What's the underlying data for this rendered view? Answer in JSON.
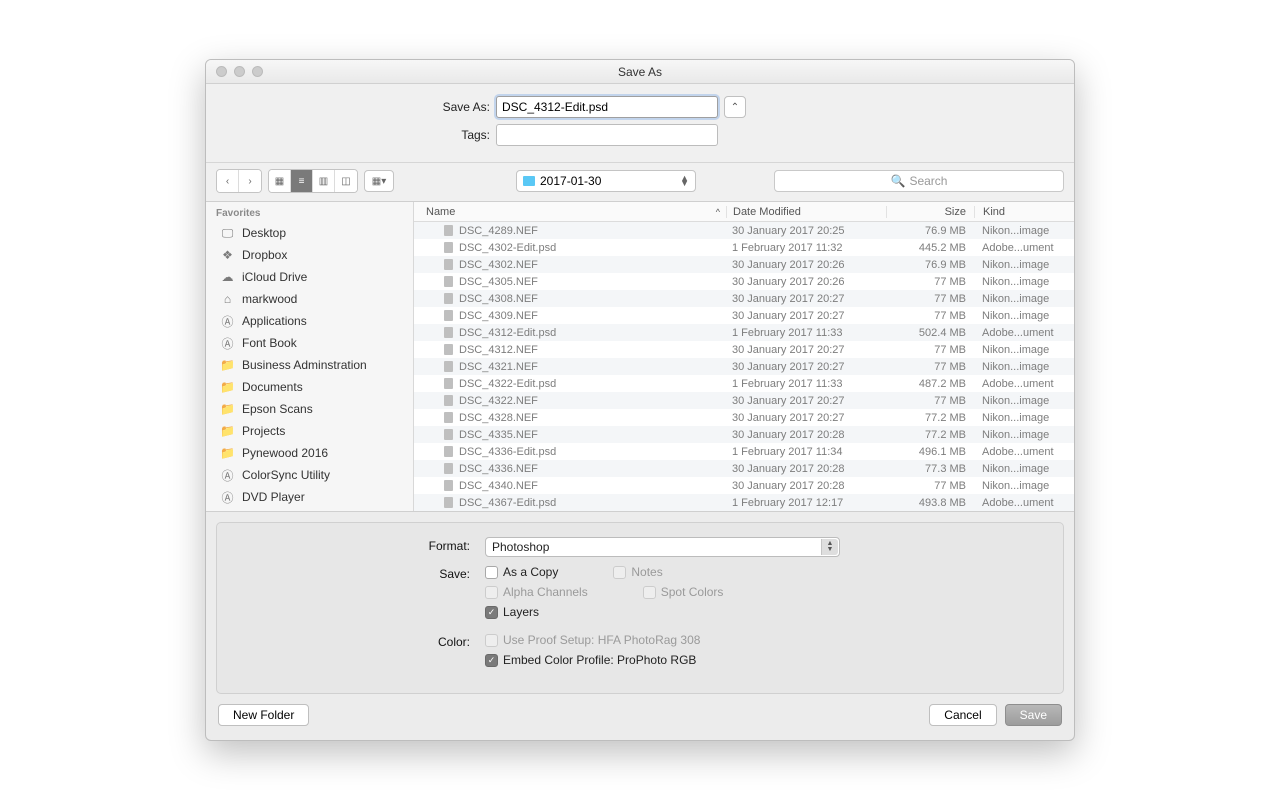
{
  "window": {
    "title": "Save As"
  },
  "form": {
    "saveas_label": "Save As:",
    "saveas_value": "DSC_4312-Edit.psd",
    "tags_label": "Tags:",
    "tags_value": ""
  },
  "location": {
    "folder": "2017-01-30"
  },
  "search": {
    "placeholder": "Search"
  },
  "sidebar": {
    "section": "Favorites",
    "items": [
      {
        "icon": "desktop",
        "label": "Desktop"
      },
      {
        "icon": "dropbox",
        "label": "Dropbox"
      },
      {
        "icon": "cloud",
        "label": "iCloud Drive"
      },
      {
        "icon": "home",
        "label": "markwood"
      },
      {
        "icon": "app",
        "label": "Applications"
      },
      {
        "icon": "app",
        "label": "Font Book"
      },
      {
        "icon": "folder",
        "label": "Business Adminstration"
      },
      {
        "icon": "folder",
        "label": "Documents"
      },
      {
        "icon": "folder",
        "label": "Epson Scans"
      },
      {
        "icon": "folder",
        "label": "Projects"
      },
      {
        "icon": "folder",
        "label": "Pynewood 2016"
      },
      {
        "icon": "app",
        "label": "ColorSync Utility"
      },
      {
        "icon": "app",
        "label": "DVD Player"
      }
    ]
  },
  "columns": {
    "name": "Name",
    "date": "Date Modified",
    "size": "Size",
    "kind": "Kind"
  },
  "files": [
    {
      "name": "DSC_4289.NEF",
      "date": "30 January 2017 20:25",
      "size": "76.9 MB",
      "kind": "Nikon...image"
    },
    {
      "name": "DSC_4302-Edit.psd",
      "date": "1 February 2017 11:32",
      "size": "445.2 MB",
      "kind": "Adobe...ument"
    },
    {
      "name": "DSC_4302.NEF",
      "date": "30 January 2017 20:26",
      "size": "76.9 MB",
      "kind": "Nikon...image"
    },
    {
      "name": "DSC_4305.NEF",
      "date": "30 January 2017 20:26",
      "size": "77 MB",
      "kind": "Nikon...image"
    },
    {
      "name": "DSC_4308.NEF",
      "date": "30 January 2017 20:27",
      "size": "77 MB",
      "kind": "Nikon...image"
    },
    {
      "name": "DSC_4309.NEF",
      "date": "30 January 2017 20:27",
      "size": "77 MB",
      "kind": "Nikon...image"
    },
    {
      "name": "DSC_4312-Edit.psd",
      "date": "1 February 2017 11:33",
      "size": "502.4 MB",
      "kind": "Adobe...ument"
    },
    {
      "name": "DSC_4312.NEF",
      "date": "30 January 2017 20:27",
      "size": "77 MB",
      "kind": "Nikon...image"
    },
    {
      "name": "DSC_4321.NEF",
      "date": "30 January 2017 20:27",
      "size": "77 MB",
      "kind": "Nikon...image"
    },
    {
      "name": "DSC_4322-Edit.psd",
      "date": "1 February 2017 11:33",
      "size": "487.2 MB",
      "kind": "Adobe...ument"
    },
    {
      "name": "DSC_4322.NEF",
      "date": "30 January 2017 20:27",
      "size": "77 MB",
      "kind": "Nikon...image"
    },
    {
      "name": "DSC_4328.NEF",
      "date": "30 January 2017 20:27",
      "size": "77.2 MB",
      "kind": "Nikon...image"
    },
    {
      "name": "DSC_4335.NEF",
      "date": "30 January 2017 20:28",
      "size": "77.2 MB",
      "kind": "Nikon...image"
    },
    {
      "name": "DSC_4336-Edit.psd",
      "date": "1 February 2017 11:34",
      "size": "496.1 MB",
      "kind": "Adobe...ument"
    },
    {
      "name": "DSC_4336.NEF",
      "date": "30 January 2017 20:28",
      "size": "77.3 MB",
      "kind": "Nikon...image"
    },
    {
      "name": "DSC_4340.NEF",
      "date": "30 January 2017 20:28",
      "size": "77 MB",
      "kind": "Nikon...image"
    },
    {
      "name": "DSC_4367-Edit.psd",
      "date": "1 February 2017 12:17",
      "size": "493.8 MB",
      "kind": "Adobe...ument"
    }
  ],
  "options": {
    "format_label": "Format:",
    "format_value": "Photoshop",
    "save_label": "Save:",
    "as_copy": "As a Copy",
    "notes": "Notes",
    "alpha": "Alpha Channels",
    "spot": "Spot Colors",
    "layers": "Layers",
    "color_label": "Color:",
    "proof_prefix": "Use Proof Setup:  ",
    "proof_value": "HFA PhotoRag 308",
    "embed_prefix": "Embed Color Profile:  ",
    "embed_value": "ProPhoto RGB"
  },
  "footer": {
    "new_folder": "New Folder",
    "cancel": "Cancel",
    "save": "Save"
  }
}
